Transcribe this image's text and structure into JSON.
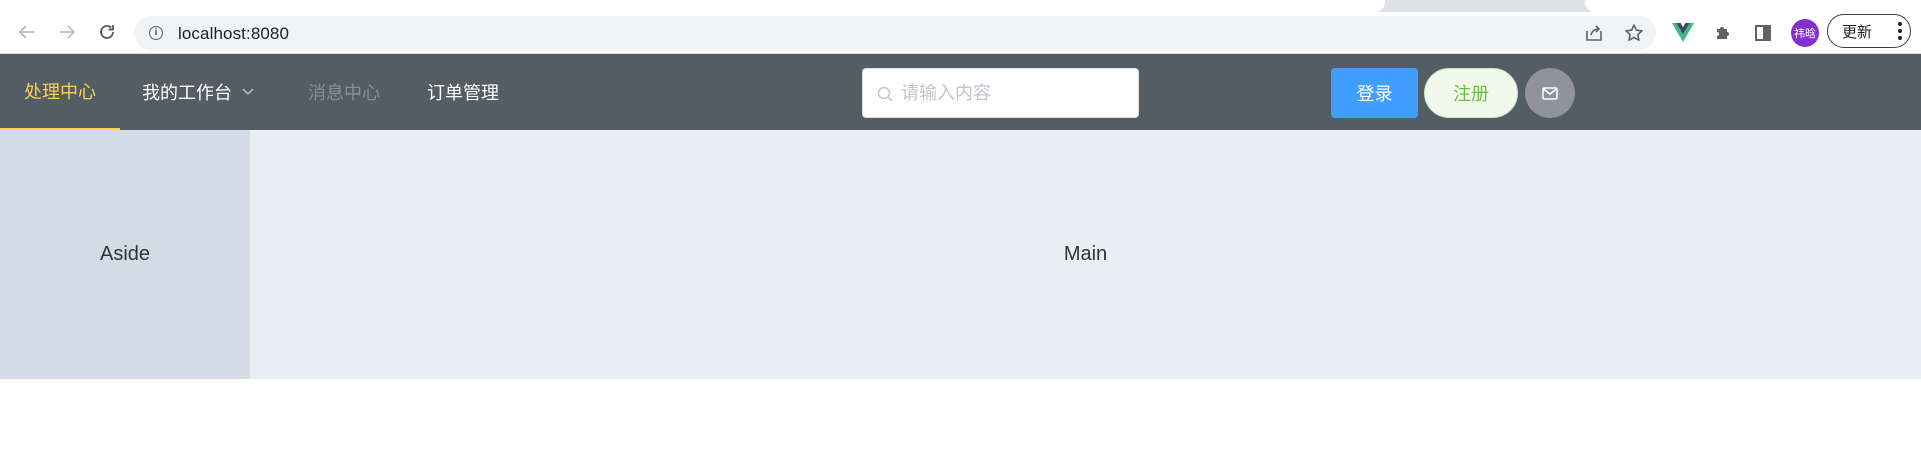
{
  "browser": {
    "url": "localhost:8080",
    "profile_initials": "祎晗",
    "update_label": "更新",
    "icons": {
      "back": "arrow-left-icon",
      "forward": "arrow-right-icon",
      "reload": "reload-icon",
      "site_info": "info-icon",
      "share": "share-icon",
      "bookmark": "star-icon",
      "vue_devtools": "vue-icon",
      "extensions": "puzzle-icon",
      "side_panel": "side-panel-icon",
      "menu": "more-vert-icon"
    }
  },
  "header": {
    "menu": [
      {
        "label": "处理中心",
        "state": "active"
      },
      {
        "label": "我的工作台",
        "state": "submenu"
      },
      {
        "label": "消息中心",
        "state": "disabled"
      },
      {
        "label": "订单管理",
        "state": "normal"
      }
    ],
    "search": {
      "placeholder": "请输入内容",
      "value": ""
    },
    "login_label": "登录",
    "register_label": "注册",
    "message_icon": "mail-icon",
    "colors": {
      "header_bg": "#545c64",
      "active_text": "#ffd04b",
      "primary": "#409eff",
      "success": "#67c23a",
      "info": "#909399"
    }
  },
  "layout": {
    "aside_label": "Aside",
    "main_label": "Main",
    "colors": {
      "aside_bg": "#d3dce6",
      "main_bg": "#e9eef3"
    }
  }
}
